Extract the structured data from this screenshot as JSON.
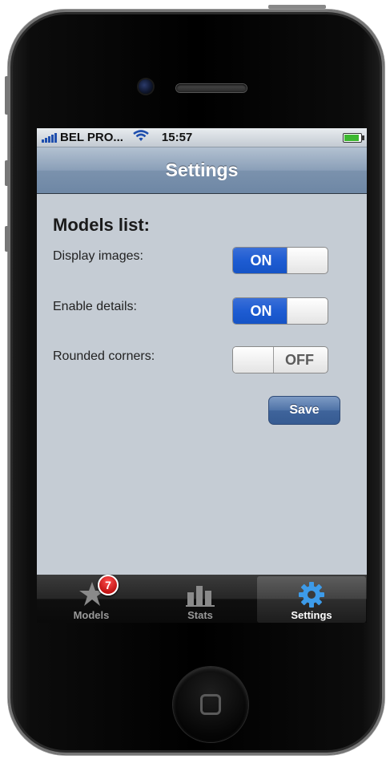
{
  "status_bar": {
    "carrier": "BEL PRO...",
    "time": "15:57",
    "signal_icon": "signal-bars-icon",
    "wifi_icon": "wifi-icon",
    "battery_icon": "battery-icon"
  },
  "nav": {
    "title": "Settings"
  },
  "settings": {
    "section_title": "Models list:",
    "rows": [
      {
        "label": "Display images:",
        "state": "ON"
      },
      {
        "label": "Enable details:",
        "state": "ON"
      },
      {
        "label": "Rounded corners:",
        "state": "OFF"
      }
    ],
    "save_label": "Save"
  },
  "tabbar": {
    "tabs": [
      {
        "label": "Models",
        "icon": "star-icon",
        "badge": "7"
      },
      {
        "label": "Stats",
        "icon": "bar-chart-icon"
      },
      {
        "label": "Settings",
        "icon": "gear-icon",
        "selected": true
      }
    ]
  },
  "colors": {
    "switch_on": "#1e5cd2",
    "screen_bg": "#c5ccd4",
    "nav_bar": "#7b92ad",
    "badge": "#d11a1a",
    "gear": "#3d9be9"
  }
}
